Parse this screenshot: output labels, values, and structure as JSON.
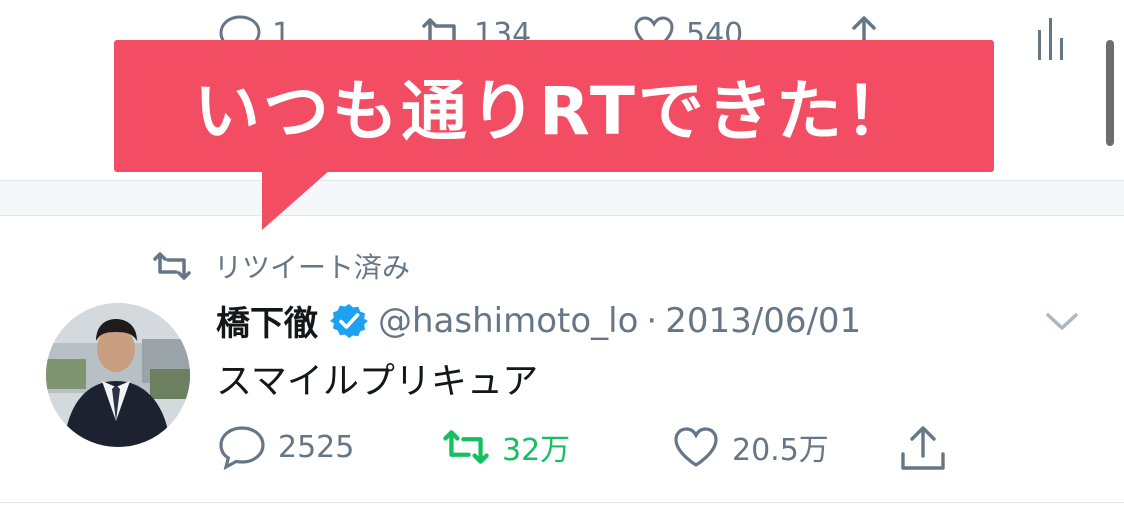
{
  "callout": {
    "text": "いつも通りRTできた！",
    "color": "#f24d63"
  },
  "previous_tweet": {
    "reply_count": "1",
    "retweet_count": "134",
    "like_count": "540"
  },
  "tweet": {
    "retweeted_label": "リツイート済み",
    "author_name": "橋下徹",
    "handle": "@hashimoto_lo",
    "separator": "·",
    "date": "2013/06/01",
    "text": "スマイルプリキュア",
    "reply_count": "2525",
    "retweet_count": "32万",
    "like_count": "20.5万",
    "verified": true
  },
  "icons": {
    "reply": "reply-icon",
    "retweet": "retweet-icon",
    "like": "heart-icon",
    "share": "share-icon",
    "analytics": "analytics-icon",
    "chevron": "chevron-down-icon"
  },
  "colors": {
    "muted": "#657786",
    "retweet_active": "#17bf63",
    "verified": "#1da1f2",
    "text": "#14171a"
  }
}
